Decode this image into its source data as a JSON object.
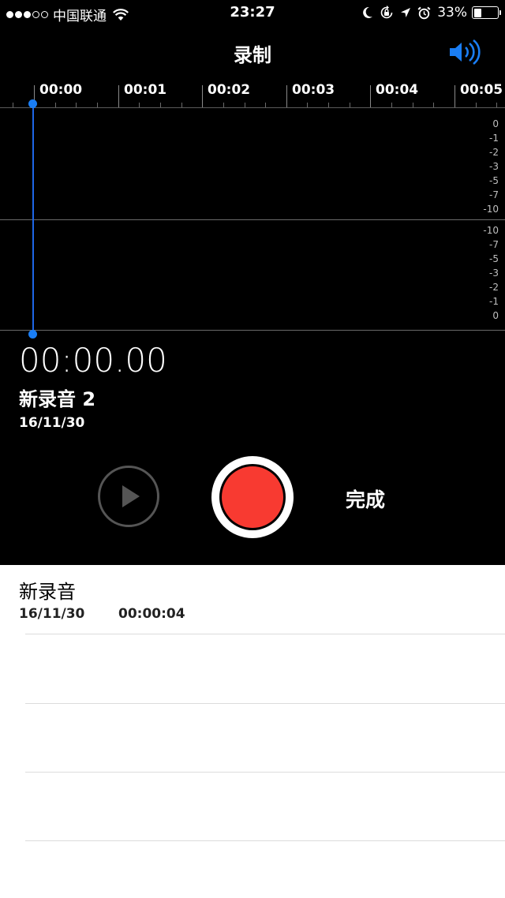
{
  "status_bar": {
    "signal_filled": 3,
    "signal_total": 5,
    "carrier": "中国联通",
    "time": "23:27",
    "battery_percent": "33%",
    "battery_level": 0.33,
    "icons": [
      "wifi-icon",
      "moon-icon",
      "orientation-lock-icon",
      "location-arrow-icon",
      "alarm-clock-icon",
      "battery-icon"
    ]
  },
  "nav": {
    "title": "录制",
    "speaker_icon": "speaker-volume-icon",
    "accent_color": "#1a7ef5"
  },
  "timeline": {
    "labels": [
      "00:00",
      "00:01",
      "00:02",
      "00:03",
      "00:04",
      "00:05"
    ]
  },
  "meter": {
    "top_channel": [
      "0",
      "-1",
      "-2",
      "-3",
      "-5",
      "-7",
      "-10"
    ],
    "bottom_channel": [
      "-10",
      "-7",
      "-5",
      "-3",
      "-2",
      "-1",
      "0"
    ]
  },
  "recording": {
    "elapsed": "00:00.00",
    "name": "新录音 2",
    "date": "16/11/30"
  },
  "controls": {
    "play_icon": "play-icon",
    "record_color": "#f83a31",
    "done_label": "完成"
  },
  "list": {
    "items": [
      {
        "name": "新录音",
        "date": "16/11/30",
        "duration": "00:00:04"
      }
    ]
  }
}
